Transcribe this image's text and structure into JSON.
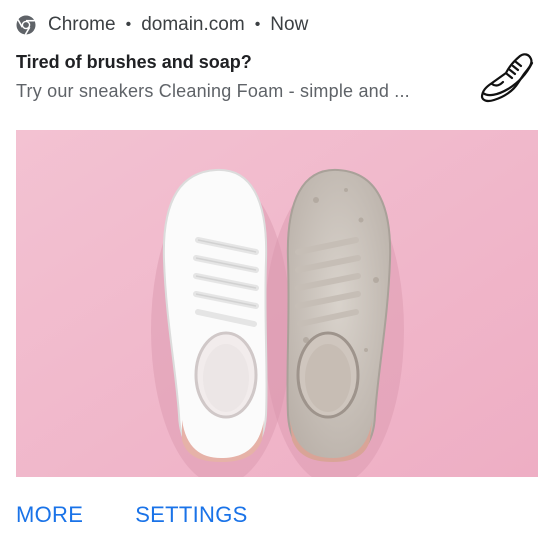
{
  "header": {
    "app_icon": "chrome-icon",
    "app_name": "Chrome",
    "separator_1": "•",
    "domain": "domain.com",
    "separator_2": "•",
    "time": "Now"
  },
  "notification": {
    "title": "Tired of brushes and soap?",
    "body": "Try our sneakers Cleaning Foam - simple and ...",
    "thumbnail_icon": "sneaker-icon",
    "image_icon": "sneakers-photo"
  },
  "actions": {
    "more_label": "MORE",
    "settings_label": "SETTINGS"
  },
  "colors": {
    "action": "#1a73e8",
    "title": "#202124",
    "body": "#5f6368",
    "image_background": "#f0b9ca"
  }
}
